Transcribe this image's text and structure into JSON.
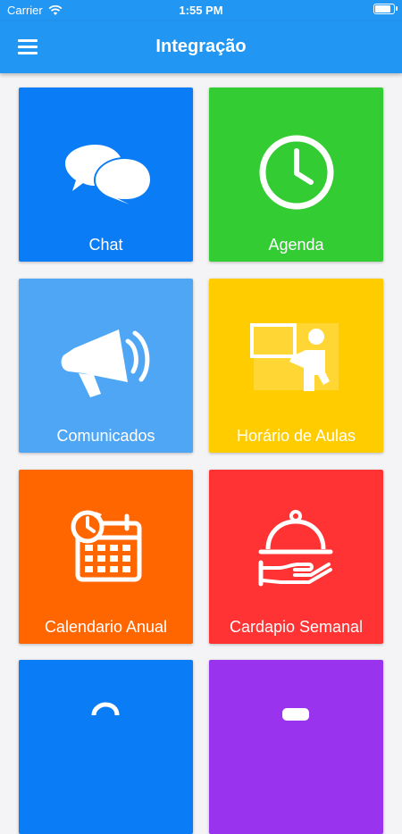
{
  "status_bar": {
    "carrier": "Carrier",
    "time": "1:55 PM",
    "battery_level": 1.0
  },
  "header": {
    "title": "Integração",
    "menu_icon": "hamburger-menu-icon"
  },
  "tiles": [
    {
      "label": "Chat",
      "color": "#0a7cf5",
      "icon": "chat-bubbles-icon"
    },
    {
      "label": "Agenda",
      "color": "#33cc33",
      "icon": "clock-icon"
    },
    {
      "label": "Comunicados",
      "color": "#4fa6f5",
      "icon": "megaphone-icon"
    },
    {
      "label": "Horário de Aulas",
      "color": "#ffcc00",
      "icon": "teacher-board-icon"
    },
    {
      "label": "Calendario Anual",
      "color": "#ff6600",
      "icon": "calendar-icon"
    },
    {
      "label": "Cardapio Semanal",
      "color": "#ff3333",
      "icon": "food-tray-icon"
    },
    {
      "label": "",
      "color": "#0a7cf5",
      "icon": "partial-icon"
    },
    {
      "label": "",
      "color": "#9933ee",
      "icon": "partial-icon"
    }
  ]
}
